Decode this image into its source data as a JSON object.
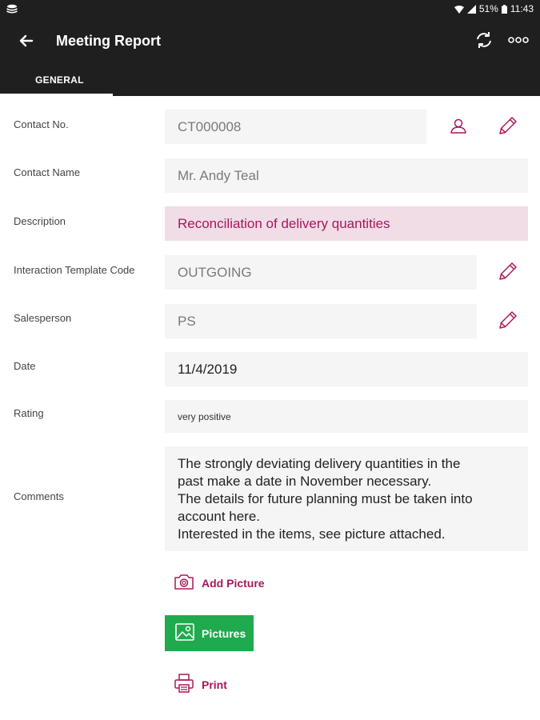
{
  "status_bar": {
    "battery": "51%",
    "time": "11:43"
  },
  "header": {
    "title": "Meeting Report",
    "tab_general": "GENERAL"
  },
  "form": {
    "contact_no": {
      "label": "Contact No.",
      "value": "CT000008"
    },
    "contact_name": {
      "label": "Contact Name",
      "value": "Mr. Andy Teal"
    },
    "description": {
      "label": "Description",
      "value": "Reconciliation of delivery quantities"
    },
    "interaction_template_code": {
      "label": "Interaction Template Code",
      "value": "OUTGOING"
    },
    "salesperson": {
      "label": "Salesperson",
      "value": "PS"
    },
    "date": {
      "label": "Date",
      "value": "11/4/2019"
    },
    "rating": {
      "label": "Rating",
      "value": "very positive"
    },
    "comments": {
      "label": "Comments",
      "lines": [
        "The strongly deviating delivery quantities in the",
        "past make a date in November necessary.",
        "The details for future planning must be taken into",
        "account here.",
        "Interested in the items, see picture attached."
      ]
    }
  },
  "actions": {
    "add_picture": "Add Picture",
    "pictures": "Pictures",
    "print": "Print"
  },
  "colors": {
    "accent": "#a8185c",
    "appbar": "#1f1f1f",
    "green_button": "#1faa4e",
    "description_bg": "#f0dde6"
  }
}
